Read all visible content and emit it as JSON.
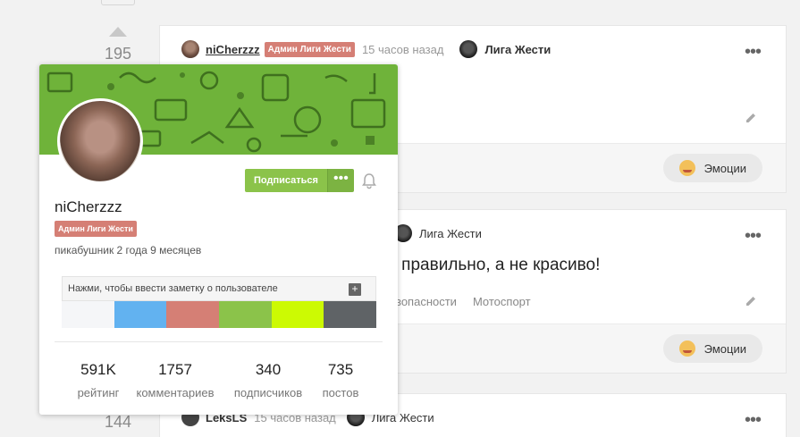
{
  "ratings": [
    "195",
    "144"
  ],
  "post1": {
    "author": "niCherzzz",
    "badge": "Админ Лиги Жести",
    "time": "15 часов назад",
    "community": "Лига Жести",
    "more": "•••",
    "emotions_label": "Эмоции"
  },
  "post2": {
    "community": "Лига Жести",
    "title_fragment": "ь правильно, а не красиво!",
    "tags": [
      "зопасности",
      "Мотоспорт"
    ],
    "more": "•••",
    "emotions_label": "Эмоции"
  },
  "post3": {
    "author": "LeksLS",
    "time": "15 часов назад",
    "community": "Лига Жести",
    "more": "•••"
  },
  "popup": {
    "username": "niCherzzz",
    "badge": "Админ Лиги Жести",
    "since": "пикабушник 2 года 9 месяцев",
    "subscribe_label": "Подписаться",
    "more_label": "•••",
    "note_placeholder": "Нажми, чтобы ввести заметку о пользователе",
    "note_add": "+",
    "note_colors": [
      "#f5f6f8",
      "#62b2f0",
      "#d57f75",
      "#8bc34a",
      "#ccfa03",
      "#5f6366"
    ],
    "stats": [
      {
        "value": "591K",
        "label": "рейтинг"
      },
      {
        "value": "1757",
        "label": "комментариев"
      },
      {
        "value": "340",
        "label": "подписчиков"
      },
      {
        "value": "735",
        "label": "постов"
      }
    ]
  },
  "colors": {
    "accent_green": "#8bc34a",
    "badge_red": "#d57f75",
    "banner_green": "#6fb33a"
  }
}
